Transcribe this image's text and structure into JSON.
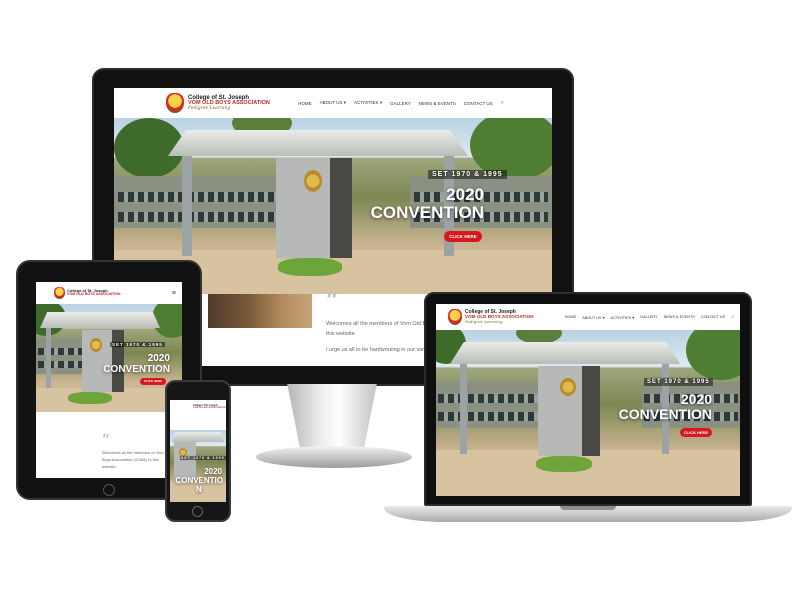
{
  "site": {
    "logo_line1": "College of St. Joseph",
    "logo_line2": "VOM OLD BOYS ASSOCIATION",
    "logo_line3": "Pedigree Learning",
    "menu": [
      {
        "label": "HOME"
      },
      {
        "label": "ABOUT US"
      },
      {
        "label": "ACTIVITIES"
      },
      {
        "label": "GALLERY"
      },
      {
        "label": "NEWS & EVENTS"
      },
      {
        "label": "CONTACT US"
      }
    ],
    "menu_caret": "▾",
    "search_icon": "search-icon",
    "menu_icon": "hamburger-menu-icon",
    "hero_tag": "SET 1970 & 1995",
    "hero_year": "2020",
    "hero_title": "CONVENTION",
    "cta_label": "CLICK HERE",
    "quote_glyph": "“",
    "welcome_line1": "Welcomes all the members of Vom Old Boys",
    "welcome_line2": "this website.",
    "welcome_line3": "I urge us all to be hardworking in our various",
    "tablet_welcome_1": "Welcomes all the members of Vom Old",
    "tablet_welcome_2": "Boys Association (VOBA) to this",
    "tablet_welcome_3": "website.",
    "phone_hero_year": "2020",
    "phone_hero_title": "CONVENTIO",
    "phone_hero_title_wrap": "N"
  },
  "colors": {
    "accent_red": "#d6191e",
    "hero_text": "#ffffff",
    "device_black": "#111111"
  }
}
